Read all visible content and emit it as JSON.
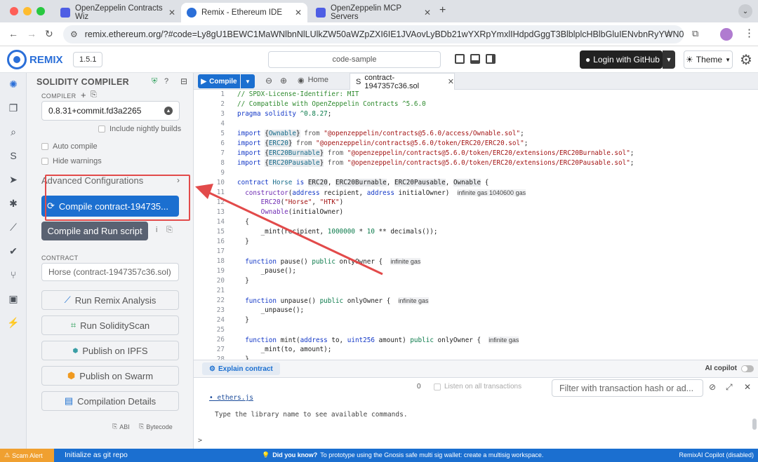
{
  "browser": {
    "tabs": [
      {
        "title": "OpenZeppelin Contracts Wiz",
        "favicon_color": "#4e5ee4"
      },
      {
        "title": "Remix - Ethereum IDE",
        "favicon_color": "#2b6fd8"
      },
      {
        "title": "OpenZeppelin MCP Servers",
        "favicon_color": "#4e5ee4"
      }
    ],
    "url": "remix.ethereum.org/?#code=Ly8gU1BEWC1MaWNlbnNlLUlkZW50aWZpZXI6IE1JVAovLyBDb21wYXRpYmxlIHdpdGggT3BlblplcHBlbGluIENvbnRyYWN0cyBeNS..."
  },
  "appbar": {
    "logo_text": "REMIX",
    "version": "1.5.1",
    "workspace": "code-sample",
    "login_label": "Login with GitHub",
    "theme_label": "Theme"
  },
  "sidebar": {
    "title": "SOLIDITY COMPILER",
    "compiler_label": "COMPILER",
    "compiler_version": "0.8.31+commit.fd3a2265",
    "nightly_label": "Include nightly builds",
    "auto_compile_label": "Auto compile",
    "hide_warnings_label": "Hide warnings",
    "advanced_label": "Advanced Configurations",
    "compile_button": "Compile contract-194735...",
    "run_script_button": "Compile and Run script",
    "contract_label": "CONTRACT",
    "contract_value": "Horse (contract-1947357c36.sol)",
    "tools": [
      {
        "label": "Run Remix Analysis"
      },
      {
        "label": "Run SolidityScan"
      },
      {
        "label": "Publish on IPFS"
      },
      {
        "label": "Publish on Swarm"
      },
      {
        "label": "Compilation Details"
      }
    ],
    "abi_label": "ABI",
    "bytecode_label": "Bytecode"
  },
  "editor": {
    "compile_label": "Compile",
    "home_label": "Home",
    "file_tab": "contract-1947357c36.sol",
    "line_numbers": [
      "1",
      "2",
      "3",
      "4",
      "5",
      "6",
      "7",
      "8",
      "9",
      "10",
      "11",
      "12",
      "13",
      "14",
      "15",
      "16",
      "17",
      "18",
      "19",
      "20",
      "21",
      "22",
      "23",
      "24",
      "25",
      "26",
      "27",
      "28"
    ],
    "gas_labels": [
      "infinite gas 1040600 gas",
      "infinite gas",
      "infinite gas",
      "infinite gas"
    ]
  },
  "terminal": {
    "explain_label": "Explain contract",
    "ai_copilot_label": "AI copilot",
    "tx_count": "0",
    "listen_label": "Listen on all transactions",
    "filter_placeholder": "Filter with transaction hash or ad...",
    "lines": [
      "• ethers.js",
      "Type the library name to see available commands."
    ],
    "prompt": ">"
  },
  "statusbar": {
    "scam_label": "Scam Alert",
    "git_label": "Initialize as git repo",
    "did_you_know_label": "Did you know?",
    "did_you_know_text": "To prototype using the Gnosis safe multi sig wallet: create a multisig workspace.",
    "copilot_status": "RemixAI Copilot (disabled)"
  },
  "colors": {
    "accent": "#1b6fd0",
    "annotation_red": "#e24a4a",
    "scam_orange": "#f0a030"
  }
}
